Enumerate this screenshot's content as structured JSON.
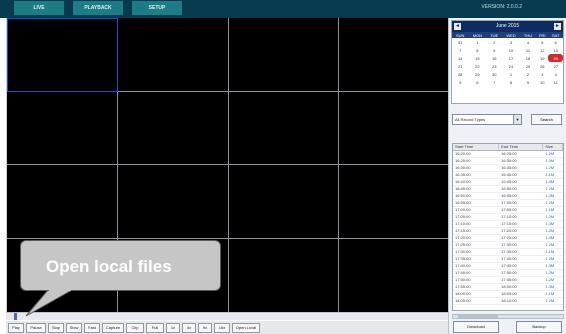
{
  "top_tabs": [
    "LIVE",
    "PLAYBACK",
    "SETUP"
  ],
  "brand_text": "VERSION: 2.0.0.2",
  "calendar": {
    "prev_label": "◄",
    "month_label": "June 2015",
    "next_label": "►",
    "weekdays": [
      "SUN",
      "MON",
      "TUE",
      "WED",
      "THU",
      "FRI",
      "SAT"
    ],
    "weeks": [
      [
        "31",
        "1",
        "2",
        "3",
        "4",
        "5",
        "6"
      ],
      [
        "7",
        "8",
        "9",
        "10",
        "11",
        "12",
        "13"
      ],
      [
        "14",
        "15",
        "16",
        "17",
        "18",
        "19",
        "20"
      ],
      [
        "21",
        "22",
        "23",
        "24",
        "25",
        "26",
        "27"
      ],
      [
        "28",
        "29",
        "30",
        "1",
        "2",
        "3",
        "4"
      ],
      [
        "5",
        "6",
        "7",
        "8",
        "9",
        "10",
        "11"
      ]
    ],
    "selected_day": "20",
    "accent_color": "#d22a2a",
    "header_color": "#0d2c63"
  },
  "record_filter": {
    "value": "All Record Types"
  },
  "search_label": "Search",
  "file_list": {
    "columns": [
      "Start Time",
      "End Time",
      "Size"
    ],
    "rows": [
      [
        "16:20:00",
        "16:25:00",
        "1.2M"
      ],
      [
        "16:25:00",
        "16:30:00",
        "1.3M"
      ],
      [
        "16:30:00",
        "16:35:00",
        "1.2M"
      ],
      [
        "16:35:00",
        "16:40:00",
        "1.1M"
      ],
      [
        "16:40:00",
        "16:45:00",
        "1.4M"
      ],
      [
        "16:45:00",
        "16:50:00",
        "1.2M"
      ],
      [
        "16:50:00",
        "16:55:00",
        "1.3M"
      ],
      [
        "16:55:00",
        "17:00:00",
        "1.2M"
      ],
      [
        "17:00:00",
        "17:05:00",
        "1.1M"
      ],
      [
        "17:05:00",
        "17:10:00",
        "1.2M"
      ],
      [
        "17:10:00",
        "17:15:00",
        "1.3M"
      ],
      [
        "17:15:00",
        "17:20:00",
        "1.2M"
      ],
      [
        "17:20:00",
        "17:25:00",
        "1.4M"
      ],
      [
        "17:25:00",
        "17:30:00",
        "1.2M"
      ],
      [
        "17:30:00",
        "17:35:00",
        "1.1M"
      ],
      [
        "17:35:00",
        "17:40:00",
        "1.2M"
      ],
      [
        "17:40:00",
        "17:45:00",
        "1.3M"
      ],
      [
        "17:45:00",
        "17:50:00",
        "1.2M"
      ],
      [
        "17:50:00",
        "17:55:00",
        "1.2M"
      ],
      [
        "17:55:00",
        "18:00:00",
        "1.3M"
      ],
      [
        "18:00:00",
        "18:05:00",
        "1.1M"
      ],
      [
        "18:05:00",
        "18:10:00",
        "1.2M"
      ]
    ]
  },
  "bottom_right_buttons": [
    "Download",
    "Backup"
  ],
  "toolbar_buttons": [
    "Play",
    "Pause",
    "Stop",
    "Slow",
    "Fast",
    "Capture",
    "Clip",
    "Full",
    "1x",
    "4x",
    "9x",
    "16x",
    "Open Local"
  ],
  "callout": {
    "text": "Open local files"
  }
}
